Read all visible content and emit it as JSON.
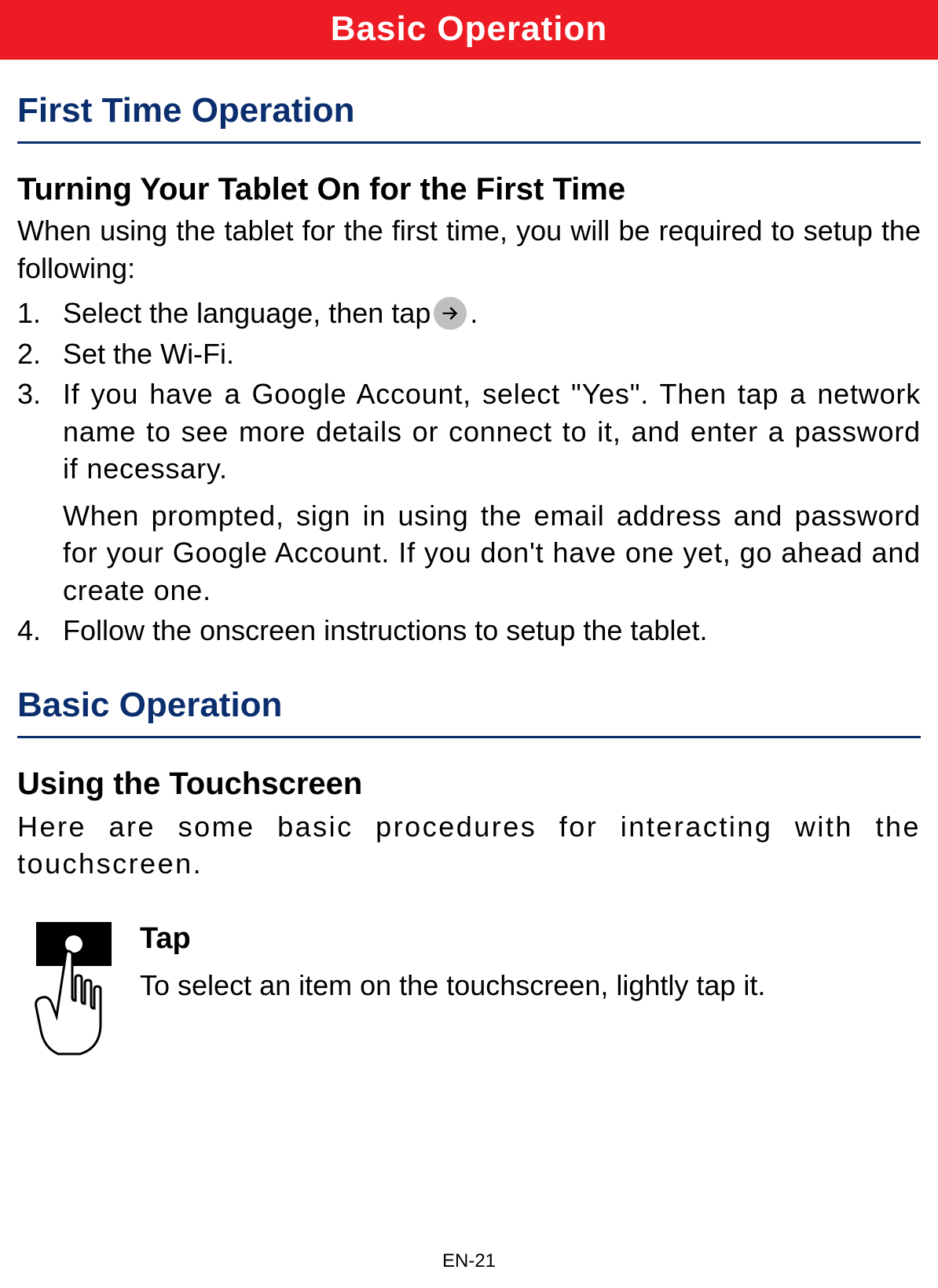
{
  "banner": "Basic Operation",
  "section1": {
    "title": "First Time Operation",
    "sub": "Turning Your Tablet On for the First Time",
    "intro": "When using the tablet for the first time, you will be required to setup the following:",
    "steps": {
      "s1_num": "1.",
      "s1_a": "Select the language, then tap",
      "s1_b": ".",
      "s2_num": "2.",
      "s2": "Set the Wi-Fi.",
      "s3_num": "3.",
      "s3a": "If you have a Google Account, select \"Yes\". Then tap a network name to see more details or connect to it, and enter a password if necessary.",
      "s3b": "When prompted, sign in using the email address and password for your Google Account. If you don't have one yet, go ahead and create one.",
      "s4_num": "4.",
      "s4": "Follow the onscreen instructions to setup the tablet."
    }
  },
  "section2": {
    "title": "Basic Operation",
    "sub": "Using the Touchscreen",
    "intro": "Here are some basic procedures for interacting with the touchscreen.",
    "tap_title": "Tap",
    "tap_body": "To select an item on the touchscreen, lightly tap it."
  },
  "footer": "EN-21"
}
